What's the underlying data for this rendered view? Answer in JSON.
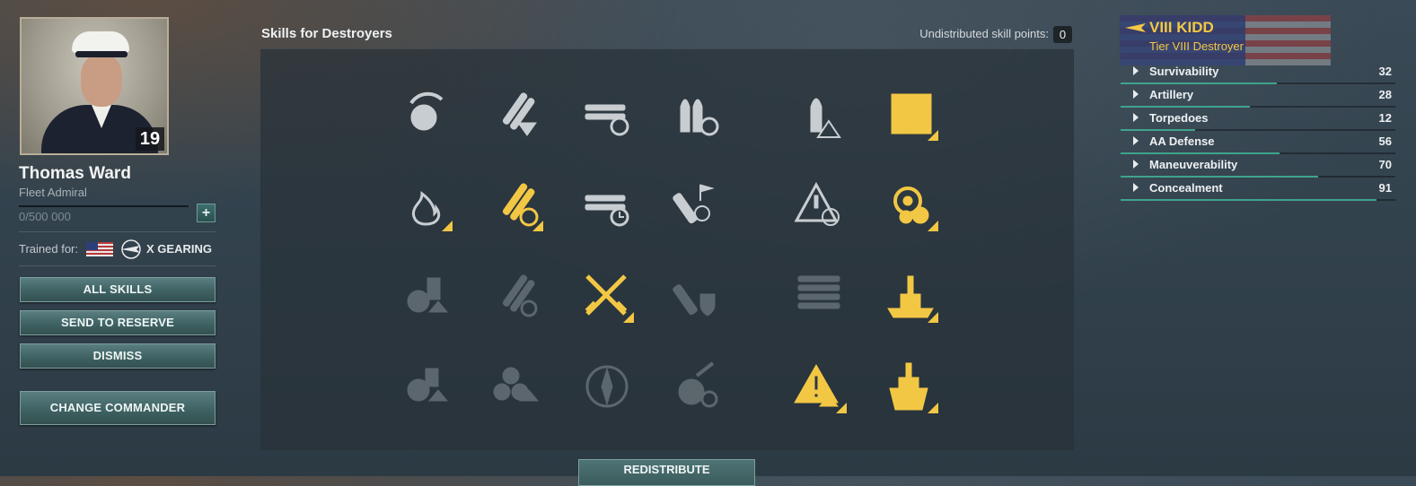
{
  "commander": {
    "name": "Thomas Ward",
    "rank": "Fleet Admiral",
    "level": "19",
    "xp": "0/500 000",
    "trained_label": "Trained for:",
    "trained_ship": "X GEARING"
  },
  "buttons": {
    "all_skills": "ALL SKILLS",
    "send_to_reserve": "SEND TO RESERVE",
    "dismiss": "DISMISS",
    "change_commander": "CHANGE COMMANDER",
    "redistribute": "REDISTRIBUTE"
  },
  "skills_panel": {
    "title": "Skills for Destroyers",
    "points_label": "Undistributed skill points:",
    "points_value": "0",
    "skill_rows": [
      [
        {
          "icon": "gun-reload-icon",
          "state": "available"
        },
        {
          "icon": "torpedo-armament-icon",
          "state": "available"
        },
        {
          "icon": "torpedo-tubes-reload-icon",
          "state": "available"
        },
        {
          "icon": "shell-reload-icon",
          "state": "available"
        },
        {
          "icon": "shell-warning-icon",
          "state": "available"
        },
        {
          "icon": "lightning-hazard-icon",
          "state": "learned"
        }
      ],
      [
        {
          "icon": "fire-icon",
          "state": "available"
        },
        {
          "icon": "torpedo-speed-icon",
          "state": "learned"
        },
        {
          "icon": "torpedo-tubes-timer-icon",
          "state": "available"
        },
        {
          "icon": "smoke-mortar-icon",
          "state": "available"
        },
        {
          "icon": "target-warning-icon",
          "state": "available"
        },
        {
          "icon": "engine-rudder-icon",
          "state": "learned"
        }
      ],
      [
        {
          "icon": "secondary-upgrade-icon",
          "state": "locked"
        },
        {
          "icon": "torpedo-reload-locked-icon",
          "state": "locked"
        },
        {
          "icon": "crossed-swords-icon",
          "state": "learned"
        },
        {
          "icon": "fire-shield-icon",
          "state": "locked"
        },
        {
          "icon": "torpedo-stack-icon",
          "state": "locked"
        },
        {
          "icon": "warship-icon",
          "state": "learned"
        }
      ],
      [
        {
          "icon": "ammo-upgrade-icon",
          "state": "locked"
        },
        {
          "icon": "propeller-upgrade-icon",
          "state": "locked"
        },
        {
          "icon": "compass-icon",
          "state": "locked"
        },
        {
          "icon": "gun-timer-icon",
          "state": "locked"
        },
        {
          "icon": "detection-warning-icon",
          "state": "learned"
        },
        {
          "icon": "ship-bow-icon",
          "state": "learned"
        }
      ]
    ]
  },
  "ship": {
    "name": "VIII KIDD",
    "subtitle": "Tier VIII Destroyer",
    "stats": [
      {
        "label": "Survivability",
        "value": "32",
        "fill": 0.57
      },
      {
        "label": "Artillery",
        "value": "28",
        "fill": 0.47
      },
      {
        "label": "Torpedoes",
        "value": "12",
        "fill": 0.27
      },
      {
        "label": "AA Defense",
        "value": "56",
        "fill": 0.58
      },
      {
        "label": "Maneuverability",
        "value": "70",
        "fill": 0.72
      },
      {
        "label": "Concealment",
        "value": "91",
        "fill": 0.93
      }
    ]
  },
  "colors": {
    "learned": "#f2c744",
    "available": "#c8cdd1",
    "locked": "#5b666d",
    "accent": "#3fa38c"
  }
}
